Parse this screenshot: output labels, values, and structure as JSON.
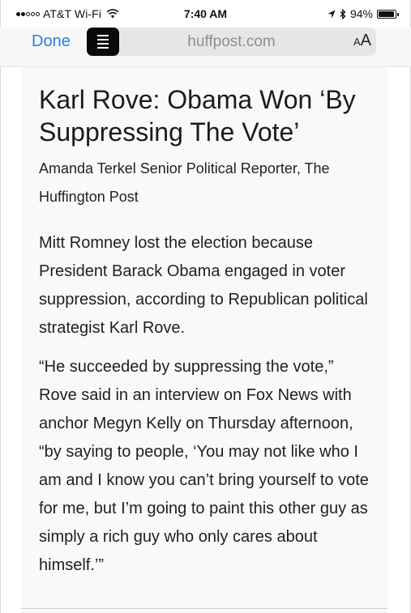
{
  "status_bar": {
    "carrier": "AT&T Wi-Fi",
    "signal_bars_filled": 2,
    "signal_bars_total": 5,
    "time": "7:40 AM",
    "battery_percent": "94%",
    "battery_level": 0.94
  },
  "toolbar": {
    "done_label": "Done",
    "url": "huffpost.com",
    "text_size_small": "A",
    "text_size_large": "A"
  },
  "article": {
    "headline": "Karl Rove: Obama Won ‘By Suppressing The Vote’",
    "byline": "Amanda Terkel Senior Political Reporter, The Huffington Post",
    "paragraphs": [
      "Mitt Romney lost the election because President Barack Obama engaged in voter suppression, according to Republican political strategist Karl Rove.",
      "“He succeeded by suppressing the vote,” Rove said in an interview on Fox News with anchor Megyn Kelly on Thursday afternoon, “by saying to people, ‘You may not like who I am and I know you can’t bring yourself to vote for me, but I’m going to paint this other guy as simply a rich guy who only cares about himself.’”"
    ]
  },
  "colors": {
    "link_blue": "#2f7ee3",
    "reader_button": "#0a0a0a",
    "url_field": "#e6e6e6",
    "article_bg": "#f9f9f9"
  }
}
